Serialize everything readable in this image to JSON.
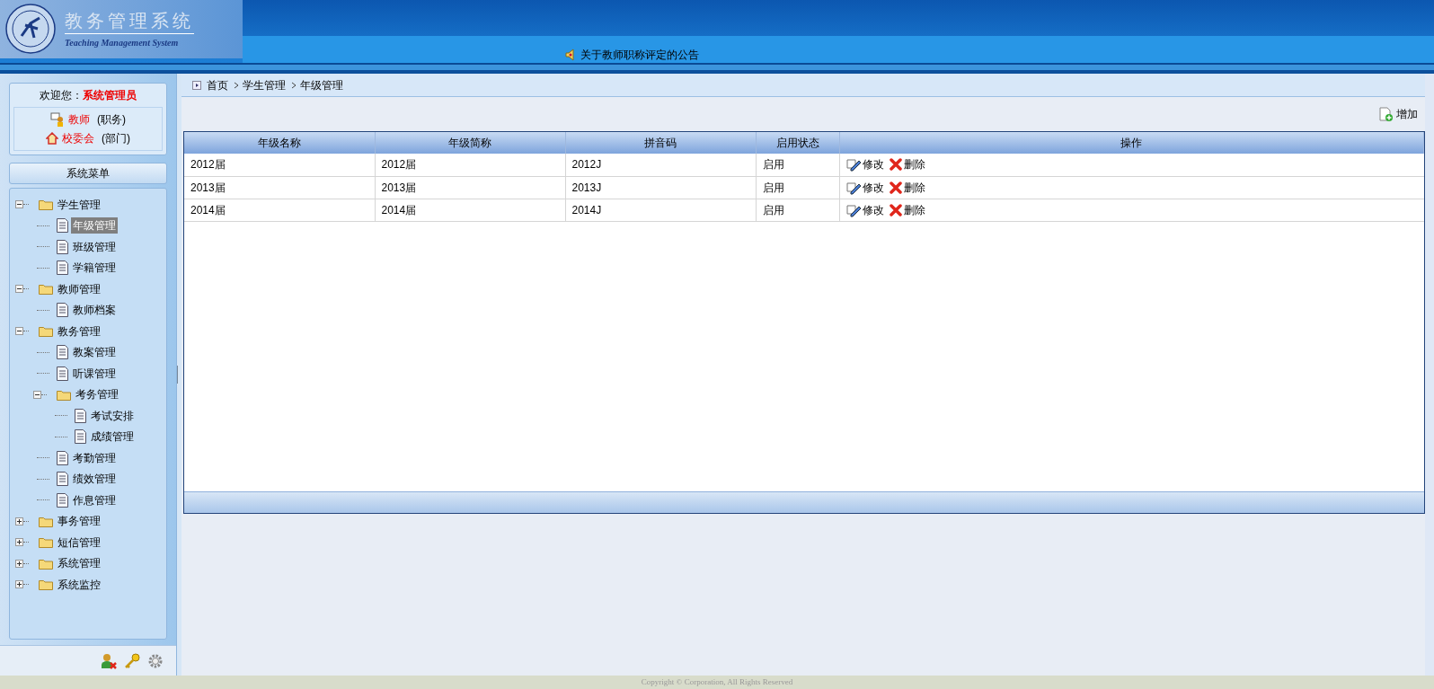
{
  "header": {
    "title": "教务管理系统",
    "subtitle": "Teaching Management System",
    "notice": "关于教师职称评定的公告"
  },
  "user": {
    "welcome": "欢迎您：",
    "name": "系统管理员",
    "role": "教师",
    "role_label": "(职务)",
    "dept": "校委会",
    "dept_label": "(部门)"
  },
  "menu_title": "系统菜单",
  "tree": [
    {
      "label": "学生管理",
      "kind": "folder",
      "expanded": true,
      "children": [
        {
          "label": "年级管理",
          "kind": "page",
          "selected": true
        },
        {
          "label": "班级管理",
          "kind": "page",
          "selected": false
        },
        {
          "label": "学籍管理",
          "kind": "page",
          "selected": false
        }
      ]
    },
    {
      "label": "教师管理",
      "kind": "folder",
      "expanded": true,
      "children": [
        {
          "label": "教师档案",
          "kind": "page",
          "selected": false
        }
      ]
    },
    {
      "label": "教务管理",
      "kind": "folder",
      "expanded": true,
      "children": [
        {
          "label": "教案管理",
          "kind": "page",
          "selected": false
        },
        {
          "label": "听课管理",
          "kind": "page",
          "selected": false
        },
        {
          "label": "考务管理",
          "kind": "folder",
          "expanded": true,
          "children": [
            {
              "label": "考试安排",
              "kind": "page",
              "selected": false
            },
            {
              "label": "成绩管理",
              "kind": "page",
              "selected": false
            }
          ]
        },
        {
          "label": "考勤管理",
          "kind": "page",
          "selected": false
        },
        {
          "label": "绩效管理",
          "kind": "page",
          "selected": false
        },
        {
          "label": "作息管理",
          "kind": "page",
          "selected": false
        }
      ]
    },
    {
      "label": "事务管理",
      "kind": "folder",
      "expanded": false
    },
    {
      "label": "短信管理",
      "kind": "folder",
      "expanded": false
    },
    {
      "label": "系统管理",
      "kind": "folder",
      "expanded": false
    },
    {
      "label": "系统监控",
      "kind": "folder",
      "expanded": false
    }
  ],
  "breadcrumb": [
    "首页",
    "学生管理",
    "年级管理"
  ],
  "add_button": "增加",
  "table": {
    "columns": [
      "年级名称",
      "年级简称",
      "拼音码",
      "启用状态",
      "操作"
    ],
    "rows": [
      {
        "cells": [
          "2012届",
          "2012届",
          "2012J",
          "启用"
        ],
        "edit": "修改",
        "delete": "删除"
      },
      {
        "cells": [
          "2013届",
          "2013届",
          "2013J",
          "启用"
        ],
        "edit": "修改",
        "delete": "删除"
      },
      {
        "cells": [
          "2014届",
          "2014届",
          "2014J",
          "启用"
        ],
        "edit": "修改",
        "delete": "删除"
      }
    ]
  },
  "footer": "Copyright © Corporation, All Rights Reserved"
}
